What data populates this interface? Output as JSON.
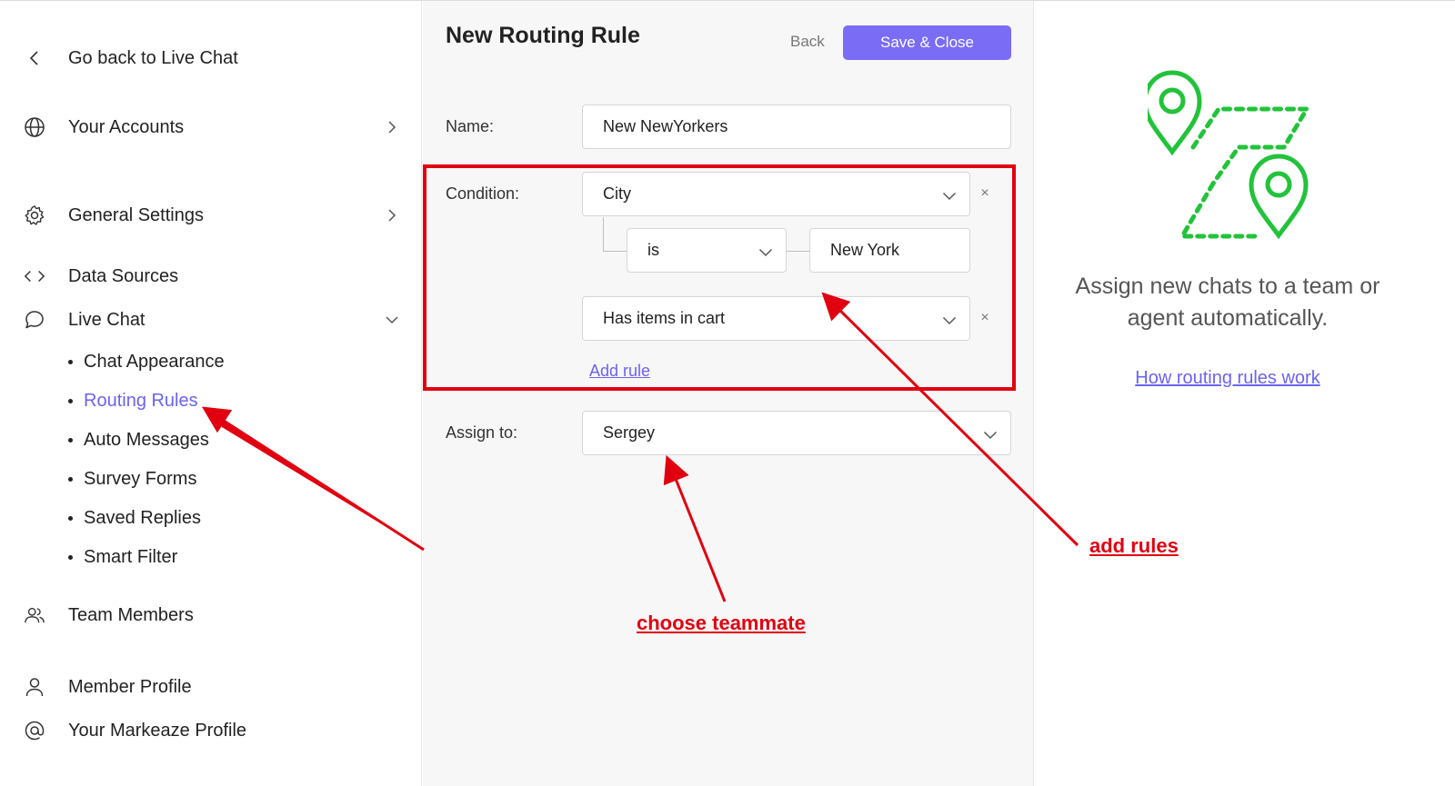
{
  "sidebar": {
    "back": "Go back to Live Chat",
    "items": [
      {
        "label": "Your Accounts"
      },
      {
        "label": "General Settings"
      },
      {
        "label": "Data Sources"
      },
      {
        "label": "Live Chat"
      }
    ],
    "live_chat_sub": [
      "Chat Appearance",
      "Routing Rules",
      "Auto Messages",
      "Survey Forms",
      "Saved Replies",
      "Smart Filter"
    ],
    "bottom_items": [
      {
        "label": "Team Members"
      },
      {
        "label": "Member Profile"
      },
      {
        "label": "Your Markeaze Profile"
      }
    ]
  },
  "form": {
    "title": "New Routing Rule",
    "back_label": "Back",
    "save_label": "Save & Close",
    "name_label": "Name:",
    "name_value": "New NewYorkers",
    "condition_label": "Condition:",
    "condition1_value": "City",
    "operator_value": "is",
    "condition1_input": "New York",
    "condition2_value": "Has items in cart",
    "add_rule_label": "Add rule",
    "assign_label": "Assign to:",
    "assign_value": "Sergey",
    "remove_symbol": "×"
  },
  "info": {
    "text": "Assign new chats to a team or agent automatically.",
    "link": "How routing rules work"
  },
  "annotations": {
    "add_rules": "add rules",
    "choose_teammate": "choose teammate"
  },
  "colors": {
    "accent": "#7b6cf6",
    "link": "#6b63f0",
    "annotation": "#e00010",
    "illustration": "#22c33a"
  }
}
